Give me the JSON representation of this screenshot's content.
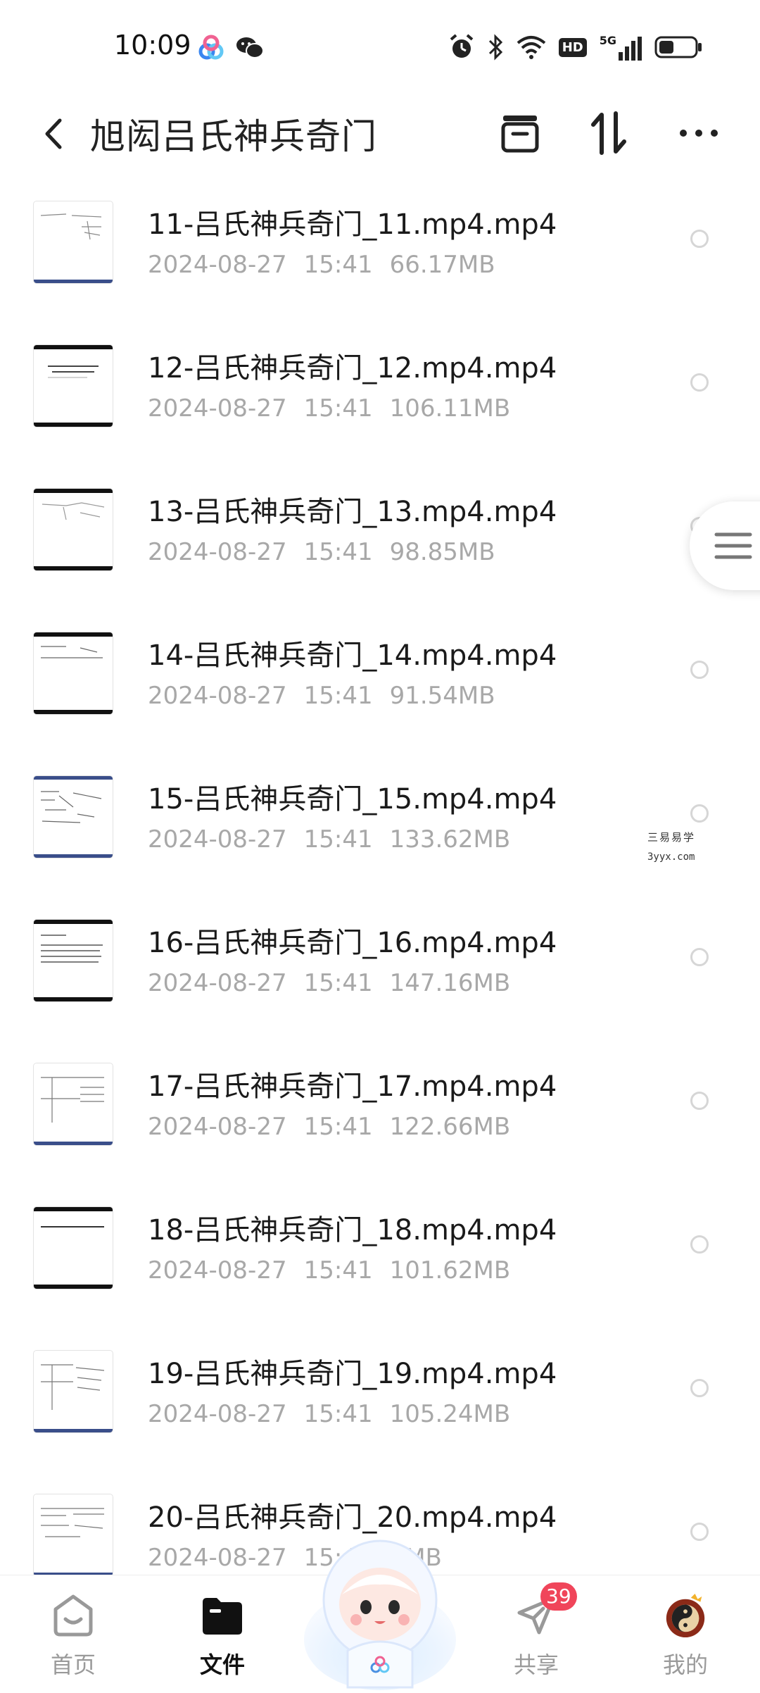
{
  "status_bar": {
    "time": "10:09",
    "left_icons": [
      "baidu-netdisk-icon",
      "wechat-icon"
    ],
    "right_icons": [
      "alarm-icon",
      "bluetooth-icon",
      "wifi-icon",
      "hd-icon",
      "5g-signal-icon",
      "battery-icon"
    ],
    "hd_label": "HD",
    "network_label": "5G",
    "battery_level": 0.35
  },
  "header": {
    "back_icon": "chevron-left-icon",
    "title": "旭闳吕氏神兵奇门",
    "actions": [
      "inbox-icon",
      "sort-icon",
      "more-icon"
    ]
  },
  "files": [
    {
      "name": "11-吕氏神兵奇门_11.mp4.mp4",
      "date": "2024-08-27",
      "time": "15:41",
      "size": "66.17MB"
    },
    {
      "name": "12-吕氏神兵奇门_12.mp4.mp4",
      "date": "2024-08-27",
      "time": "15:41",
      "size": "106.11MB"
    },
    {
      "name": "13-吕氏神兵奇门_13.mp4.mp4",
      "date": "2024-08-27",
      "time": "15:41",
      "size": "98.85MB"
    },
    {
      "name": "14-吕氏神兵奇门_14.mp4.mp4",
      "date": "2024-08-27",
      "time": "15:41",
      "size": "91.54MB"
    },
    {
      "name": "15-吕氏神兵奇门_15.mp4.mp4",
      "date": "2024-08-27",
      "time": "15:41",
      "size": "133.62MB"
    },
    {
      "name": "16-吕氏神兵奇门_16.mp4.mp4",
      "date": "2024-08-27",
      "time": "15:41",
      "size": "147.16MB"
    },
    {
      "name": "17-吕氏神兵奇门_17.mp4.mp4",
      "date": "2024-08-27",
      "time": "15:41",
      "size": "122.66MB"
    },
    {
      "name": "18-吕氏神兵奇门_18.mp4.mp4",
      "date": "2024-08-27",
      "time": "15:41",
      "size": "101.62MB"
    },
    {
      "name": "19-吕氏神兵奇门_19.mp4.mp4",
      "date": "2024-08-27",
      "time": "15:41",
      "size": "105.24MB"
    },
    {
      "name": "20-吕氏神兵奇门_20.mp4.mp4",
      "date": "2024-08-27",
      "time": "15:4",
      "size": "97MB"
    }
  ],
  "watermark": {
    "line1": "三易易学",
    "line2": "3yyx.com"
  },
  "float_menu_icon": "menu-lines-icon",
  "bottom_nav": {
    "items": [
      {
        "label": "首页",
        "icon": "home-icon",
        "active": false
      },
      {
        "label": "文件",
        "icon": "folder-icon",
        "active": true
      },
      {
        "label": "",
        "icon": "mascot-icon",
        "active": false
      },
      {
        "label": "共享",
        "icon": "share-icon",
        "active": false,
        "badge": "39"
      },
      {
        "label": "我的",
        "icon": "profile-avatar-icon",
        "active": false
      }
    ]
  },
  "colors": {
    "text_primary": "#1a1a1a",
    "text_secondary": "#a8a8a8",
    "badge": "#f0455a",
    "active_nav": "#111111"
  }
}
